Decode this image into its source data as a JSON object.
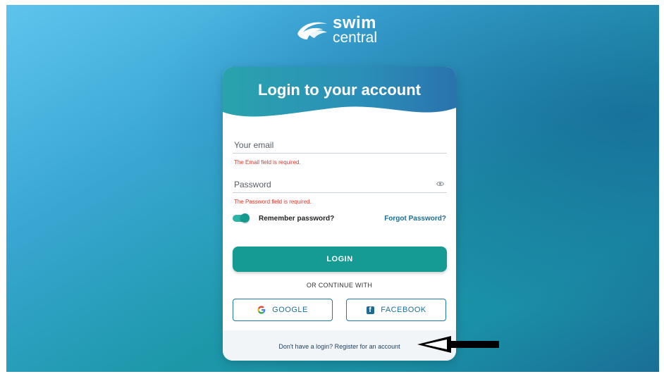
{
  "brand": {
    "logo_line1": "swim",
    "logo_line2": "central"
  },
  "login": {
    "title": "Login to your account",
    "email_label": "Your email",
    "email_value": "",
    "email_error": "The Email field is required.",
    "password_label": "Password",
    "password_value": "",
    "password_error": "The Password field is required.",
    "remember_label": "Remember password?",
    "remember_checked": true,
    "forgot_label": "Forgot Password?",
    "login_button": "LOGIN",
    "or_text": "OR CONTINUE WITH",
    "google_button": "GOOGLE",
    "facebook_button": "FACEBOOK",
    "register_text": "Don't have a login? Register for an account"
  },
  "icons": {
    "brand": "swim-central-logo-icon",
    "password_toggle": "eye-icon",
    "google": "google-icon",
    "facebook": "facebook-icon",
    "annotation": "arrow-left-icon"
  },
  "colors": {
    "accent": "#159a94",
    "link": "#1b6d93",
    "error": "#e0352b",
    "toggle": "#2cb5a7",
    "background_light": "#5ec4ee",
    "background_dark": "#1a6e96"
  }
}
